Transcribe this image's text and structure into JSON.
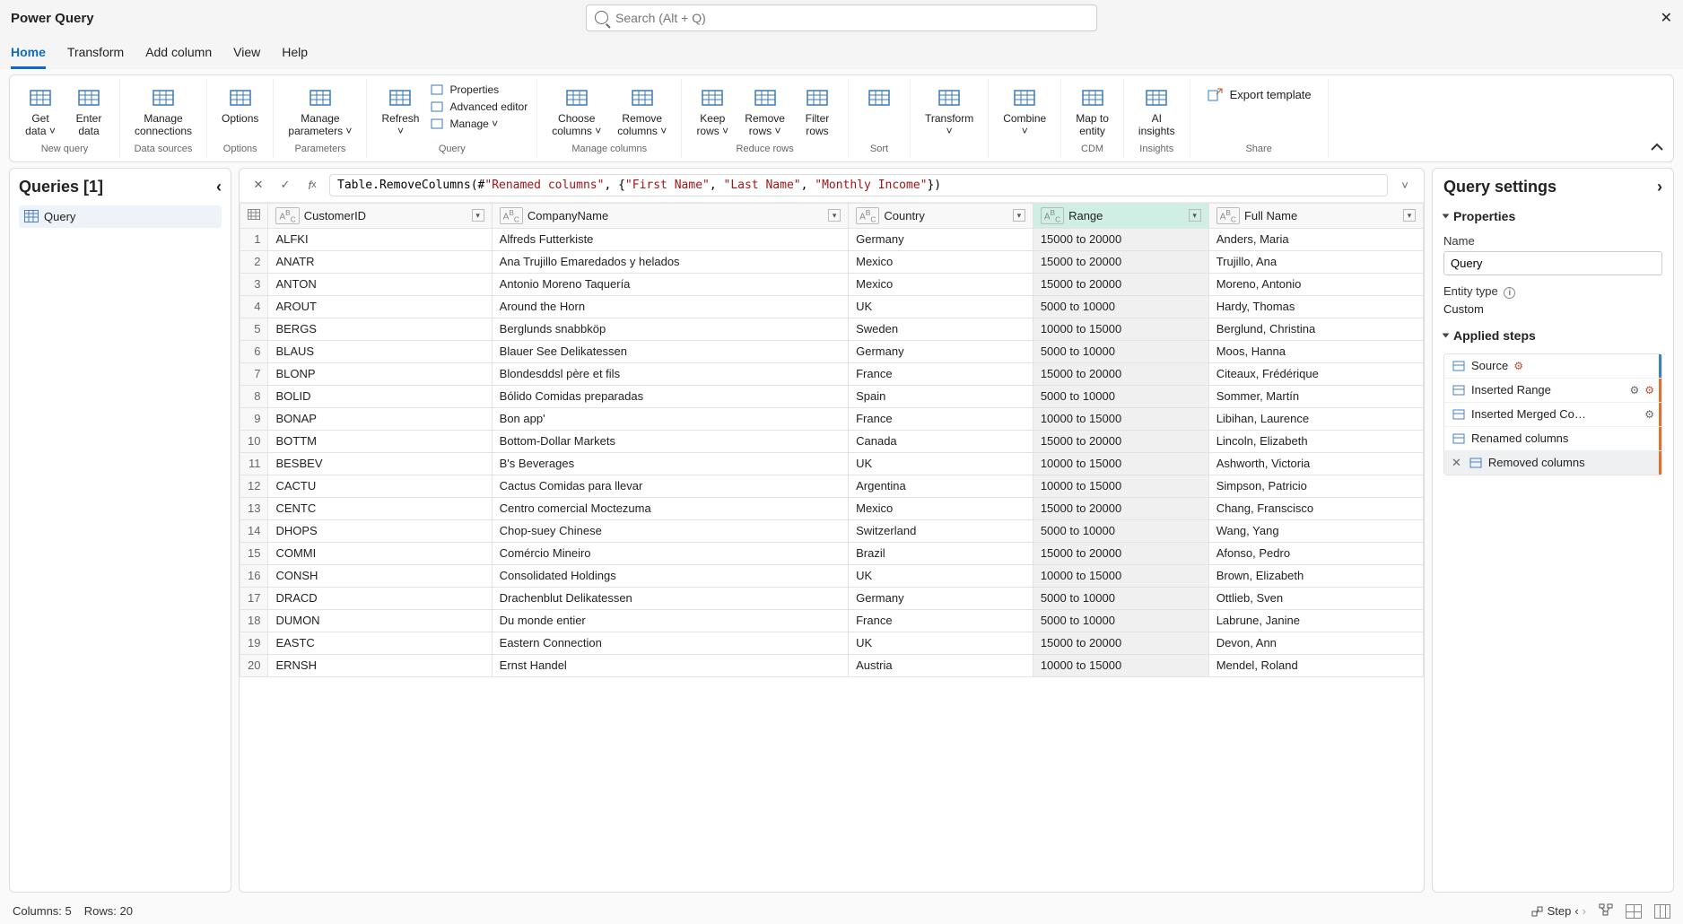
{
  "title": "Power Query",
  "search_placeholder": "Search (Alt + Q)",
  "menu_tabs": [
    "Home",
    "Transform",
    "Add column",
    "View",
    "Help"
  ],
  "ribbon": {
    "groups": [
      {
        "label": "New query",
        "buttons": [
          {
            "label": "Get\ndata ˅"
          },
          {
            "label": "Enter\ndata"
          }
        ]
      },
      {
        "label": "Data sources",
        "buttons": [
          {
            "label": "Manage\nconnections"
          }
        ]
      },
      {
        "label": "Options",
        "buttons": [
          {
            "label": "Options"
          }
        ]
      },
      {
        "label": "Parameters",
        "buttons": [
          {
            "label": "Manage\nparameters ˅"
          }
        ]
      },
      {
        "label": "Query",
        "buttons": [
          {
            "label": "Refresh\n˅"
          }
        ],
        "vert": [
          {
            "label": "Properties"
          },
          {
            "label": "Advanced editor"
          },
          {
            "label": "Manage ˅"
          }
        ]
      },
      {
        "label": "Manage columns",
        "buttons": [
          {
            "label": "Choose\ncolumns ˅"
          },
          {
            "label": "Remove\ncolumns ˅"
          }
        ]
      },
      {
        "label": "Reduce rows",
        "buttons": [
          {
            "label": "Keep\nrows ˅"
          },
          {
            "label": "Remove\nrows ˅"
          },
          {
            "label": "Filter\nrows"
          }
        ]
      },
      {
        "label": "Sort",
        "buttons": [
          {
            "label": ""
          }
        ]
      },
      {
        "label": "",
        "buttons": [
          {
            "label": "Transform\n˅"
          }
        ]
      },
      {
        "label": "",
        "buttons": [
          {
            "label": "Combine\n˅"
          }
        ]
      },
      {
        "label": "CDM",
        "buttons": [
          {
            "label": "Map to\nentity"
          }
        ]
      },
      {
        "label": "Insights",
        "buttons": [
          {
            "label": "AI\ninsights"
          }
        ]
      },
      {
        "label": "Share",
        "export": "Export template"
      }
    ]
  },
  "queries": {
    "title": "Queries [1]",
    "items": [
      "Query"
    ]
  },
  "formula": {
    "pre": "Table.RemoveColumns(#",
    "s": [
      "\"Renamed columns\"",
      "\"First Name\"",
      "\"Last Name\"",
      "\"Monthly Income\""
    ]
  },
  "columns": [
    "CustomerID",
    "CompanyName",
    "Country",
    "Range",
    "Full Name"
  ],
  "selected_col": 3,
  "rows": [
    [
      "ALFKI",
      "Alfreds Futterkiste",
      "Germany",
      "15000 to 20000",
      "Anders, Maria"
    ],
    [
      "ANATR",
      "Ana Trujillo Emaredados y helados",
      "Mexico",
      "15000 to 20000",
      "Trujillo, Ana"
    ],
    [
      "ANTON",
      "Antonio Moreno Taquería",
      "Mexico",
      "15000 to 20000",
      "Moreno, Antonio"
    ],
    [
      "AROUT",
      "Around the Horn",
      "UK",
      "5000 to 10000",
      "Hardy, Thomas"
    ],
    [
      "BERGS",
      "Berglunds snabbköp",
      "Sweden",
      "10000 to 15000",
      "Berglund, Christina"
    ],
    [
      "BLAUS",
      "Blauer See Delikatessen",
      "Germany",
      "5000 to 10000",
      "Moos, Hanna"
    ],
    [
      "BLONP",
      "Blondesddsl père et fils",
      "France",
      "15000 to 20000",
      "Citeaux, Frédérique"
    ],
    [
      "BOLID",
      "Bólido Comidas preparadas",
      "Spain",
      "5000 to 10000",
      "Sommer, Martín"
    ],
    [
      "BONAP",
      "Bon app'",
      "France",
      "10000 to 15000",
      "Libihan, Laurence"
    ],
    [
      "BOTTM",
      "Bottom-Dollar Markets",
      "Canada",
      "15000 to 20000",
      "Lincoln, Elizabeth"
    ],
    [
      "BESBEV",
      "B's Beverages",
      "UK",
      "10000 to 15000",
      "Ashworth, Victoria"
    ],
    [
      "CACTU",
      "Cactus Comidas para llevar",
      "Argentina",
      "10000 to 15000",
      "Simpson, Patricio"
    ],
    [
      "CENTC",
      "Centro comercial Moctezuma",
      "Mexico",
      "15000 to 20000",
      "Chang, Franscisco"
    ],
    [
      "DHOPS",
      "Chop-suey Chinese",
      "Switzerland",
      "5000 to 10000",
      "Wang, Yang"
    ],
    [
      "COMMI",
      "Comércio Mineiro",
      "Brazil",
      "15000 to 20000",
      "Afonso, Pedro"
    ],
    [
      "CONSH",
      "Consolidated Holdings",
      "UK",
      "10000 to 15000",
      "Brown, Elizabeth"
    ],
    [
      "DRACD",
      "Drachenblut Delikatessen",
      "Germany",
      "5000 to 10000",
      "Ottlieb, Sven"
    ],
    [
      "DUMON",
      "Du monde entier",
      "France",
      "5000 to 10000",
      "Labrune, Janine"
    ],
    [
      "EASTC",
      "Eastern Connection",
      "UK",
      "15000 to 20000",
      "Devon, Ann"
    ],
    [
      "ERNSH",
      "Ernst Handel",
      "Austria",
      "10000 to 15000",
      "Mendel, Roland"
    ]
  ],
  "settings": {
    "title": "Query settings",
    "sect_props": "Properties",
    "name_label": "Name",
    "name_value": "Query",
    "entity_label": "Entity type",
    "entity_value": "Custom",
    "sect_steps": "Applied steps",
    "steps": [
      {
        "label": "Source",
        "gear": false,
        "gearx": true,
        "bar": "blue"
      },
      {
        "label": "Inserted Range",
        "gear": true,
        "gearx": true,
        "bar": "orange"
      },
      {
        "label": "Inserted Merged Co…",
        "gear": true,
        "gearx": false,
        "bar": "orange"
      },
      {
        "label": "Renamed columns",
        "gear": false,
        "gearx": false,
        "bar": "orange"
      },
      {
        "label": "Removed columns",
        "gear": false,
        "gearx": false,
        "bar": "orange",
        "active": true,
        "del": true
      }
    ]
  },
  "status": {
    "cols": "Columns: 5",
    "rows": "Rows: 20",
    "step": "Step"
  }
}
